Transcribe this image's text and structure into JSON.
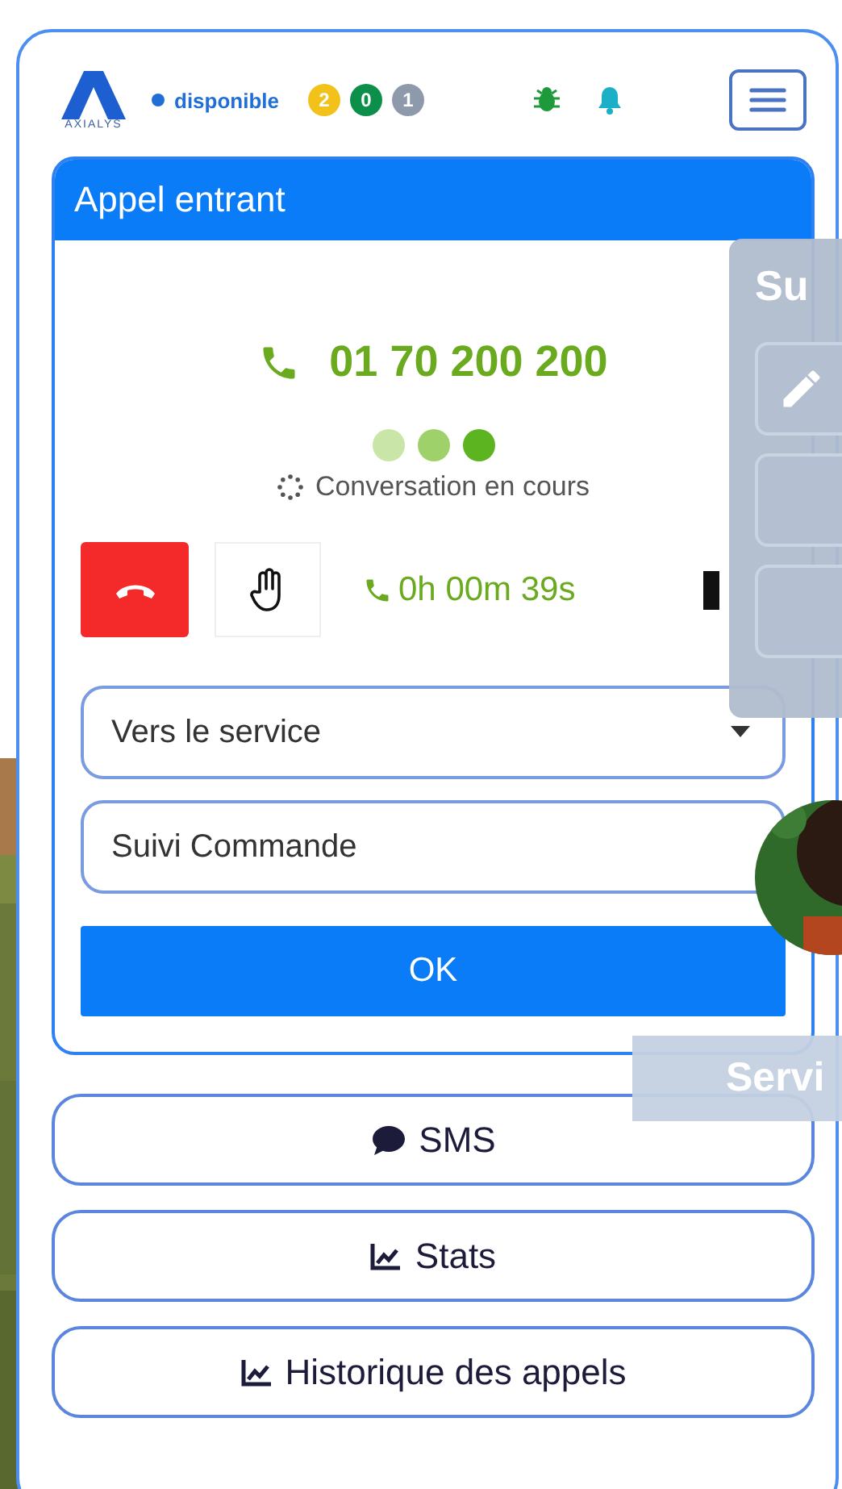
{
  "header": {
    "logo_text": "AXIALYS",
    "status": {
      "label": "disponible",
      "color": "#1f6fd6"
    },
    "badges": [
      {
        "count": "2",
        "color": "#f2c11a"
      },
      {
        "count": "0",
        "color": "#0b8f4a"
      },
      {
        "count": "1",
        "color": "#8e9aab"
      }
    ],
    "menu_open": false
  },
  "call_panel": {
    "title": "Appel entrant",
    "number": "01 70 200 200",
    "dots": [
      {
        "color": "#c9e6a8"
      },
      {
        "color": "#9fd16a"
      },
      {
        "color": "#5cb520"
      }
    ],
    "status": "Conversation en cours",
    "timer": "0h 00m 39s",
    "transfer_select": {
      "value": "Vers le service"
    },
    "target_field": {
      "value": "Suivi Commande"
    },
    "ok_button": "OK"
  },
  "menu_buttons": [
    {
      "label": "SMS",
      "kind": "sms"
    },
    {
      "label": "Stats",
      "kind": "chart"
    },
    {
      "label": "Historique des appels",
      "kind": "chart"
    }
  ],
  "side_panel": {
    "title": "Su",
    "buttons": [
      {
        "kind": "pencil"
      },
      {
        "kind": "empty"
      },
      {
        "kind": "empty"
      }
    ]
  },
  "service_bar": {
    "label": "Servi"
  }
}
